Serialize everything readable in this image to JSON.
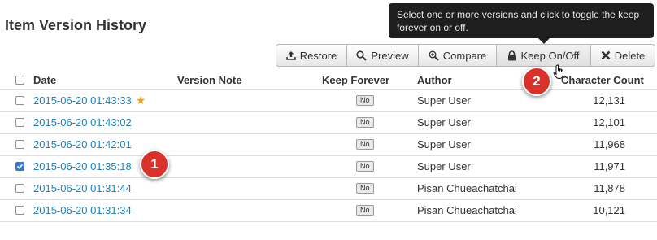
{
  "page": {
    "title": "Item Version History"
  },
  "tooltip": {
    "text": "Select one or more versions and click to toggle the keep forever on or off."
  },
  "toolbar": {
    "restore_label": "Restore",
    "preview_label": "Preview",
    "compare_label": "Compare",
    "keep_label": "Keep On/Off",
    "delete_label": "Delete"
  },
  "table": {
    "headers": {
      "date": "Date",
      "version_note": "Version Note",
      "keep_forever": "Keep Forever",
      "author": "Author",
      "character_count": "Character Count"
    },
    "rows": [
      {
        "date": "2015-06-20 01:43:33",
        "starred": true,
        "note": "",
        "keep": "No",
        "author": "Super User",
        "count": "12,131",
        "checked": false
      },
      {
        "date": "2015-06-20 01:43:02",
        "starred": false,
        "note": "",
        "keep": "No",
        "author": "Super User",
        "count": "12,101",
        "checked": false
      },
      {
        "date": "2015-06-20 01:42:01",
        "starred": false,
        "note": "",
        "keep": "No",
        "author": "Super User",
        "count": "11,968",
        "checked": false
      },
      {
        "date": "2015-06-20 01:35:18",
        "starred": false,
        "note": "",
        "keep": "No",
        "author": "Super User",
        "count": "11,971",
        "checked": true
      },
      {
        "date": "2015-06-20 01:31:44",
        "starred": false,
        "note": "",
        "keep": "No",
        "author": "Pisan Chueachatchai",
        "count": "11,878",
        "checked": false
      },
      {
        "date": "2015-06-20 01:31:34",
        "starred": false,
        "note": "",
        "keep": "No",
        "author": "Pisan Chueachatchai",
        "count": "10,121",
        "checked": false
      }
    ]
  },
  "annotations": {
    "marker_1": "1",
    "marker_2": "2"
  },
  "colors": {
    "link": "#1f82b8",
    "star": "#f4a31c",
    "marker": "#d8322b",
    "checkbox_checked": "#2f7bd6",
    "tooltip_bg": "#1e1e1e"
  }
}
